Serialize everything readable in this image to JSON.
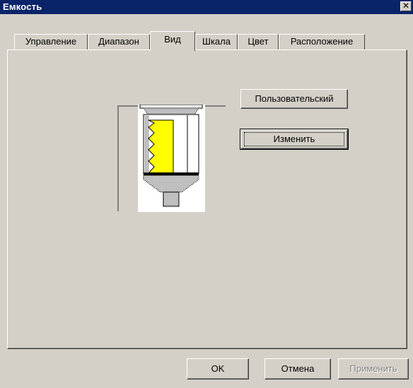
{
  "window": {
    "title": "Емкость",
    "close_glyph": "✕"
  },
  "tabs": [
    {
      "label": "Управление",
      "active": false
    },
    {
      "label": "Диапазон",
      "active": false
    },
    {
      "label": "Вид",
      "active": true
    },
    {
      "label": "Шкала",
      "active": false
    },
    {
      "label": "Цвет",
      "active": false
    },
    {
      "label": "Расположение",
      "active": false
    }
  ],
  "view_tab": {
    "custom_button": "Пользовательский",
    "change_button": "Изменить",
    "tank_fill_color": "#ffff00"
  },
  "footer": {
    "ok_button": "OK",
    "cancel_button": "Отмена",
    "apply_button": "Применить",
    "apply_enabled": false
  }
}
